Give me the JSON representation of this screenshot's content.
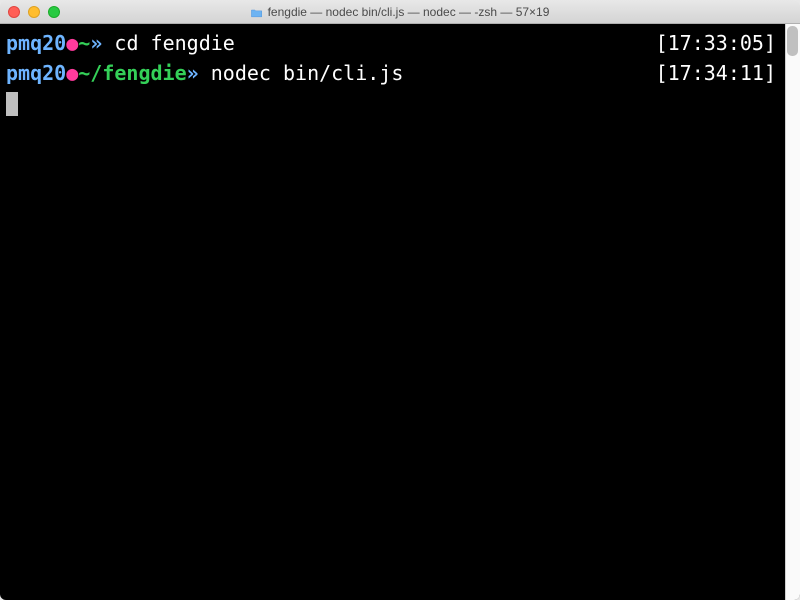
{
  "window": {
    "title": "fengdie — nodec bin/cli.js — nodec — -zsh — 57×19"
  },
  "terminal": {
    "lines": [
      {
        "user": "pmq20",
        "dot": "●",
        "path": "~",
        "arrow": "»",
        "command": "cd fengdie",
        "timestamp": "[17:33:05]"
      },
      {
        "user": "pmq20",
        "dot": "●",
        "path": "~/fengdie",
        "arrow": "»",
        "command": "nodec bin/cli.js",
        "timestamp": "[17:34:11]"
      }
    ]
  }
}
